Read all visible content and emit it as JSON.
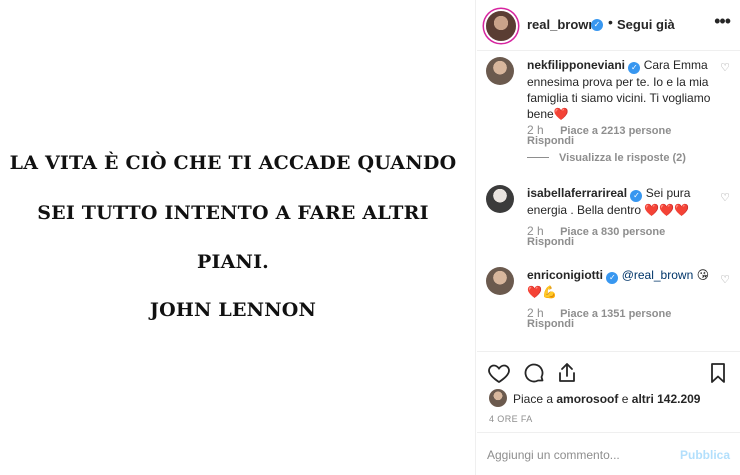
{
  "post": {
    "quote_lines": [
      "LA VITA È CIÒ CHE TI ACCADE QUANDO",
      "SEI TUTTO INTENTO A FARE ALTRI",
      "PIANI.",
      "JOHN LENNON"
    ]
  },
  "header": {
    "username": "real_brown",
    "separator": "•",
    "follow_label": "Segui già",
    "more_icon": "more-options-icon"
  },
  "comments": [
    {
      "username": "nekfilipponeviani",
      "verified": true,
      "text": "Cara Emma ennesima prova per te. Io e la mia famiglia ti siamo vicini. Ti vogliamo bene",
      "emoji": "❤️",
      "time": "2 h",
      "likes": "Piace a 2213 persone",
      "reply": "Rispondi",
      "view_replies": "Visualizza le risposte (2)"
    },
    {
      "username": "isabellaferrarireal",
      "verified": true,
      "text": "Sei pura energia . Bella dentro",
      "emoji": "❤️❤️❤️",
      "time": "2 h",
      "likes": "Piace a 830 persone",
      "reply": "Rispondi"
    },
    {
      "username": "enriconigiotti",
      "verified": true,
      "mention": "@real_brown",
      "emoji": "😘",
      "emoji2": "❤️💪",
      "time": "2 h",
      "likes": "Piace a 1351 persone",
      "reply": "Rispondi"
    }
  ],
  "likes_summary": {
    "prefix": "Piace a",
    "user": "amorosoof",
    "conj": "e",
    "others": "altri 142.209"
  },
  "timestamp": "4 ORE FA",
  "comment_input": {
    "placeholder": "Aggiungi un commento...",
    "publish_label": "Pubblica"
  },
  "colors": {
    "verified": "#3897f0",
    "muted": "#8e8e8e",
    "publish_disabled": "#b2dffc",
    "heart_red": "#ed4956"
  }
}
